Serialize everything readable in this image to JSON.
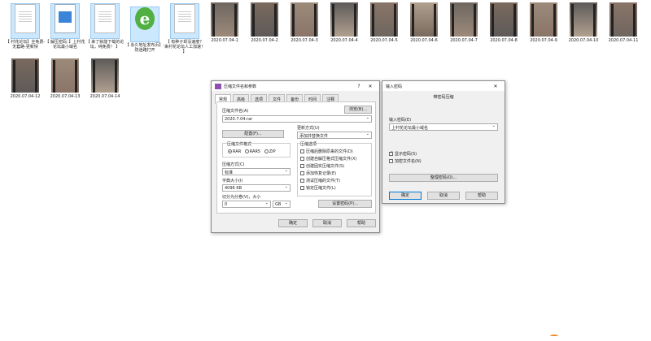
{
  "files_row1": [
    {
      "name": "【 村花论坛】全免费-无套路-更新快",
      "kind": "doc"
    },
    {
      "name": "【 解压密码：】上村花论坛最小域名",
      "kind": "image"
    },
    {
      "name": "【 来了就能下载的论坛，纯免费！ 】",
      "kind": "doc"
    },
    {
      "name": "【 永久地址发布页】-防迷路打开",
      "kind": "ie"
    },
    {
      "name": "【 有种子却没速度？来村花论坛人工加速！ 】",
      "kind": "doc"
    },
    {
      "name": "2020.07.04-1",
      "kind": "video"
    },
    {
      "name": "2020.07.04-2",
      "kind": "video"
    },
    {
      "name": "2020.07.04-3",
      "kind": "video"
    },
    {
      "name": "2020.07.04-4",
      "kind": "video"
    },
    {
      "name": "2020.07.04-5",
      "kind": "video"
    },
    {
      "name": "2020.07.04-6",
      "kind": "video"
    },
    {
      "name": "2020.07.04-7",
      "kind": "video"
    },
    {
      "name": "2020.07.04-8",
      "kind": "video"
    },
    {
      "name": "2020.07.04-9",
      "kind": "video"
    },
    {
      "name": "2020.07.04-10",
      "kind": "video"
    },
    {
      "name": "2020.07.04-11",
      "kind": "video"
    }
  ],
  "files_row2": [
    {
      "name": "2020.07.04-12",
      "kind": "video"
    },
    {
      "name": "2020.07.04-13",
      "kind": "video"
    },
    {
      "name": "2020.07.04-14",
      "kind": "video"
    }
  ],
  "archive_dialog": {
    "title": "压缩文件名和参数",
    "tabs": [
      "常规",
      "高级",
      "选项",
      "文件",
      "备份",
      "时间",
      "注释"
    ],
    "archive_name_label": "压缩文件名(A)",
    "archive_name_value": "2020.7.04.rar",
    "browse_button": "浏览(B)...",
    "update_mode_label": "更新方式(U)",
    "update_mode_value": "添加并替换文件",
    "profile_button": "配置(F)...",
    "format_label": "压缩文件格式",
    "format_options": [
      "RAR",
      "RAR5",
      "ZIP"
    ],
    "method_label": "压缩方式(C)",
    "method_value": "标准",
    "dict_label": "字典大小(I)",
    "dict_value": "4096 KB",
    "split_label": "切分为分卷(V)，大小",
    "split_value": "0",
    "split_unit": "GB",
    "options_label": "压缩选项",
    "options": [
      "压缩后删除原来的文件(D)",
      "创建自解压格式压缩文件(X)",
      "创建固实压缩文件(S)",
      "添加恢复记录(E)",
      "测试压缩的文件(T)",
      "锁定压缩文件(L)"
    ],
    "set_password_button": "设置密码(P)...",
    "ok_button": "确定",
    "cancel_button": "取消",
    "help_button": "帮助"
  },
  "password_dialog": {
    "title": "输入密码",
    "subtitle": "带密码压缩",
    "password_label": "输入密码(E)",
    "password_value": "上村花论坛最小域名",
    "show_password": "显示密码(S)",
    "encrypt_names": "加密文件名(N)",
    "organize_button": "整理密码(O)...",
    "ok_button": "确定",
    "cancel_button": "取消",
    "help_button": "帮助"
  }
}
